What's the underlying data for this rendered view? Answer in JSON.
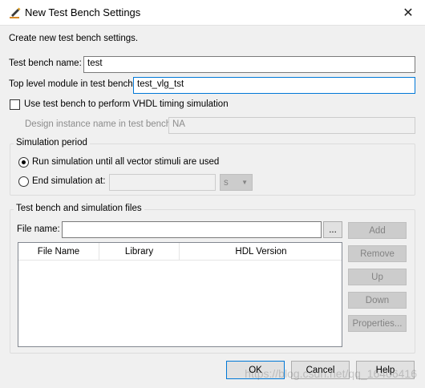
{
  "window": {
    "title": "New Test Bench Settings",
    "icon": "pencil-icon",
    "close_glyph": "✕"
  },
  "intro_text": "Create new test bench settings.",
  "test_bench_name": {
    "label": "Test bench name:",
    "value": "test"
  },
  "top_level_module": {
    "label": "Top level module in test bench:",
    "value": "test_vlg_tst"
  },
  "vhdl_timing": {
    "label": "Use test bench to perform VHDL timing simulation",
    "checked": false
  },
  "design_instance": {
    "label": "Design instance name in test bench:",
    "value": "NA"
  },
  "simulation_period": {
    "title": "Simulation period",
    "run_all": {
      "label": "Run simulation until all vector stimuli are used",
      "checked": true
    },
    "end_at": {
      "label": "End simulation at:",
      "value": "",
      "unit": "s"
    }
  },
  "files": {
    "title": "Test bench and simulation files",
    "file_name_label": "File name:",
    "file_name_value": "",
    "browse_label": "...",
    "columns": [
      "File Name",
      "Library",
      "HDL Version"
    ],
    "buttons": {
      "add": "Add",
      "remove": "Remove",
      "up": "Up",
      "down": "Down",
      "properties": "Properties..."
    }
  },
  "footer": {
    "ok": "OK",
    "cancel": "Cancel",
    "help": "Help"
  },
  "watermark": "https://blog.csdn.net/qq_16406416"
}
